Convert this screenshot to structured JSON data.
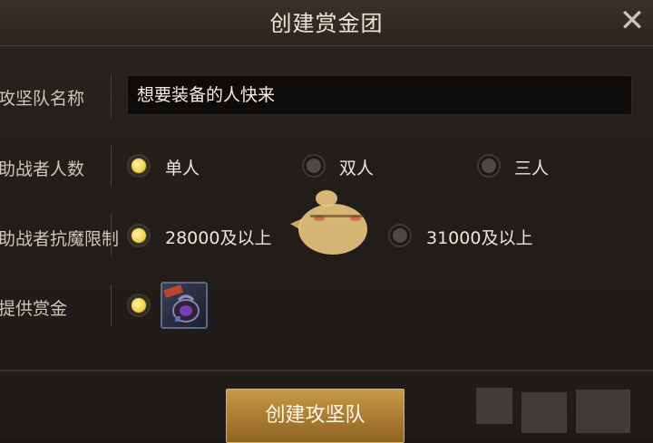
{
  "dialog": {
    "title": "创建赏金团",
    "close_icon": "close-icon"
  },
  "rows": {
    "team_name": {
      "label": "攻坚队名称",
      "value": "想要装备的人快来"
    },
    "player_count": {
      "label": "助战者人数",
      "options": [
        {
          "label": "单人",
          "selected": true
        },
        {
          "label": "双人",
          "selected": false
        },
        {
          "label": "三人",
          "selected": false
        }
      ]
    },
    "resistance_limit": {
      "label": "助战者抗魔限制",
      "options": [
        {
          "label": "28000及以上",
          "selected": true
        },
        {
          "label": "31000及以上",
          "selected": false
        }
      ]
    },
    "bounty": {
      "label": "提供赏金",
      "selected": true,
      "item_icon": "bounty-bag-icon"
    }
  },
  "create_button": {
    "label": "创建攻坚队"
  },
  "colors": {
    "accent_gold": "#c79a4a",
    "radio_on": "#f0d24e",
    "radio_off": "#4c4946"
  }
}
